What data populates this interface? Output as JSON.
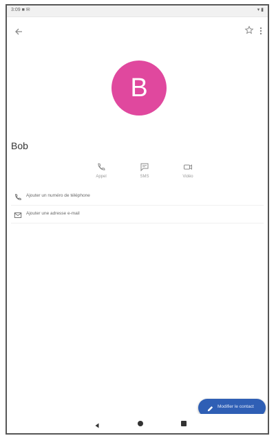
{
  "status_bar": {
    "left_text": "3:09 ■ ✉",
    "right_text": "▾ ▮"
  },
  "contact": {
    "initial": "B",
    "name": "Bob",
    "avatar_color": "#e0489e"
  },
  "quick_actions": [
    {
      "icon": "phone-icon",
      "label": "Appel"
    },
    {
      "icon": "message-icon",
      "label": "SMS"
    },
    {
      "icon": "video-icon",
      "label": "Vidéo"
    }
  ],
  "detail_rows": [
    {
      "icon": "phone-icon",
      "text": "Ajouter un numéro de téléphone"
    },
    {
      "icon": "email-icon",
      "text": "Ajouter une adresse e-mail"
    }
  ],
  "fab": {
    "label": "Modifier le contact",
    "color": "#2f5fb5"
  }
}
